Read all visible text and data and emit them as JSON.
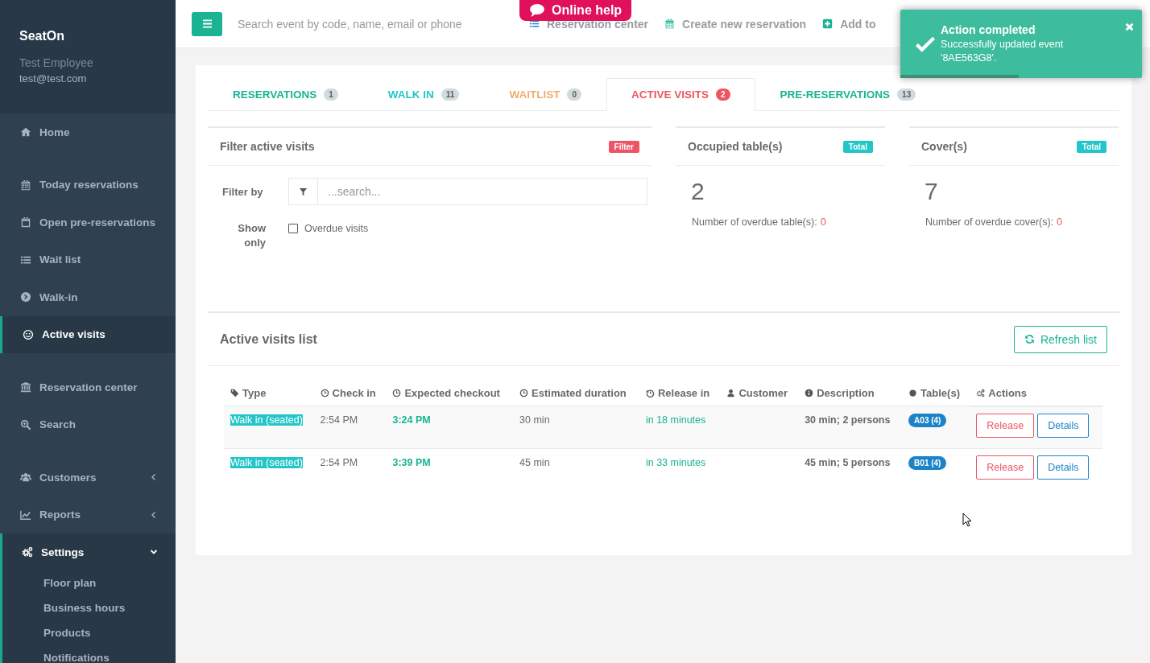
{
  "sidebar": {
    "brand": "SeatOn",
    "user_name": "Test Employee",
    "user_email": "test@test.com",
    "sections": [
      {
        "items": [
          {
            "label": "Home",
            "selected": false
          }
        ]
      },
      {
        "items": [
          {
            "label": "Today reservations",
            "selected": false
          },
          {
            "label": "Open pre-reservations",
            "selected": false
          },
          {
            "label": "Wait list",
            "selected": false
          },
          {
            "label": "Walk-in",
            "selected": false
          },
          {
            "label": "Active visits",
            "selected": true
          }
        ]
      },
      {
        "items": [
          {
            "label": "Reservation center",
            "selected": false
          },
          {
            "label": "Search",
            "selected": false
          }
        ]
      },
      {
        "items": [
          {
            "label": "Customers",
            "selected": false,
            "expanded": false
          },
          {
            "label": "Reports",
            "selected": false,
            "expanded": false
          },
          {
            "label": "Settings",
            "selected": false,
            "expanded": true,
            "children": [
              {
                "label": "Floor plan"
              },
              {
                "label": "Business hours"
              },
              {
                "label": "Products"
              },
              {
                "label": "Notifications"
              }
            ]
          }
        ]
      }
    ]
  },
  "header": {
    "search": {
      "placeholder": "Search event by code, name, email or phone"
    },
    "online_help": "Online help",
    "links": [
      "Reservation center",
      "Create new reservation",
      "Add to"
    ]
  },
  "toast": {
    "title": "Action completed",
    "message": "Successfully updated event '8AE563G8'.",
    "level": 0.49
  },
  "tabs": [
    {
      "label": "RESERVATIONS",
      "count": "1",
      "color": "#1ab394",
      "selected": false
    },
    {
      "label": "WALK IN",
      "count": "11",
      "color": "#23c6c8",
      "selected": false
    },
    {
      "label": "WAITLIST",
      "count": "0",
      "color": "#f0ad6e",
      "selected": false
    },
    {
      "label": "ACTIVE VISITS",
      "count": "2",
      "color": "#ed5565",
      "selected": true
    },
    {
      "label": "PRE-RESERVATIONS",
      "count": "13",
      "color": "#1ab394",
      "selected": false
    }
  ],
  "filter_panel": {
    "title": "Filter active visits",
    "badge": "Filter",
    "filter_label": "Filter by",
    "search": {
      "placeholder": "...search..."
    },
    "show_only_label": "Show only",
    "overdue_checkbox": {
      "label": "Overdue visits",
      "checked": false
    }
  },
  "stats": [
    {
      "title": "Occupied table(s)",
      "badge": "Total",
      "value": "2",
      "note": "Number of overdue table(s):",
      "overdue": "0"
    },
    {
      "title": "Cover(s)",
      "badge": "Total",
      "value": "7",
      "note": "Number of overdue cover(s):",
      "overdue": "0"
    }
  ],
  "list": {
    "title": "Active visits list",
    "refresh_button": "Refresh list",
    "columns": [
      "Type",
      "Check in",
      "Expected checkout",
      "Estimated duration",
      "Release in",
      "Customer",
      "Description",
      "Table(s)",
      "Actions"
    ],
    "rows": [
      {
        "type": "Walk in (seated)",
        "check_in": "2:54 PM",
        "expected_checkout": "3:24 PM",
        "duration": "30 min",
        "release_in": "in 18 minutes",
        "description": "30 min; 2 persons",
        "table": "A03 (4)",
        "actions": [
          "Release",
          "Details"
        ]
      },
      {
        "type": "Walk in (seated)",
        "check_in": "2:54 PM",
        "expected_checkout": "3:39 PM",
        "duration": "45 min",
        "release_in": "in 33 minutes",
        "description": "45 min; 5 persons",
        "table": "B01 (4)",
        "actions": [
          "Release",
          "Details"
        ]
      }
    ]
  }
}
